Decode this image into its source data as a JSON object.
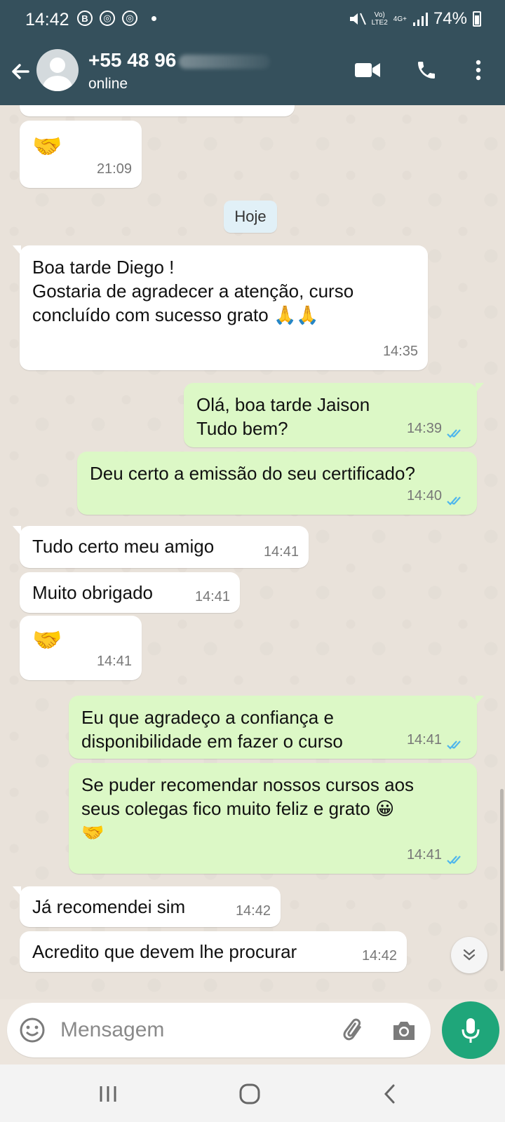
{
  "status_bar": {
    "time": "14:42",
    "network_top": "Vo)",
    "network_bottom": "LTE2",
    "signal_type": "4G+",
    "battery": "74%"
  },
  "header": {
    "contact_name": "+55 48 96",
    "status": "online",
    "icons": [
      "back-arrow-icon",
      "video-call-icon",
      "phone-icon",
      "more-options-icon"
    ]
  },
  "chat": {
    "date_chip": "Hoje",
    "messages": [
      {
        "dir": "in",
        "text": "🤝",
        "time": "21:09"
      },
      {
        "dir": "in",
        "text": "Boa tarde Diego !\nGostaria de agradecer a atenção, curso\nconcluído com sucesso grato 🙏🙏",
        "time": "14:35"
      },
      {
        "dir": "out",
        "text": "Olá, boa tarde Jaison\nTudo bem?",
        "time": "14:39",
        "read": true
      },
      {
        "dir": "out",
        "text": "Deu certo a emissão do seu certificado?",
        "time": "14:40",
        "read": true
      },
      {
        "dir": "in",
        "text": "Tudo certo meu amigo",
        "time": "14:41"
      },
      {
        "dir": "in",
        "text": "Muito obrigado",
        "time": "14:41"
      },
      {
        "dir": "in",
        "text": "🤝",
        "time": "14:41"
      },
      {
        "dir": "out",
        "text": "Eu que agradeço a confiança e\ndisponibilidade em fazer o curso",
        "time": "14:41",
        "read": true
      },
      {
        "dir": "out",
        "text": "Se puder recomendar nossos cursos aos\nseus colegas fico muito feliz e grato 😀\n🤝",
        "time": "14:41",
        "read": true
      },
      {
        "dir": "in",
        "text": "Já recomendei sim",
        "time": "14:42"
      },
      {
        "dir": "in",
        "text": "Acredito que devem lhe procurar",
        "time": "14:42"
      }
    ]
  },
  "input": {
    "placeholder": "Mensagem"
  },
  "colors": {
    "header": "#35505c",
    "incoming": "#ffffff",
    "outgoing": "#dcf8c6",
    "mic_button": "#1fa67a",
    "read_ticks": "#4fb6ec"
  }
}
